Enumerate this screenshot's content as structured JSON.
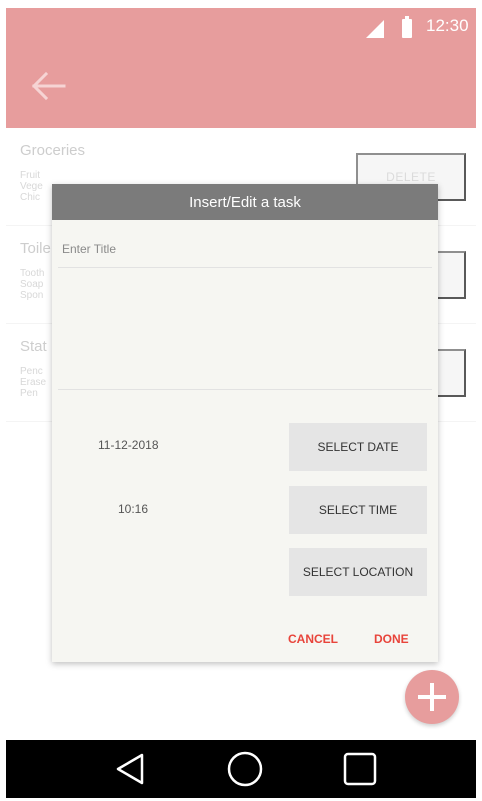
{
  "status_bar": {
    "time": "12:30"
  },
  "app_bar": {
    "back_icon": "arrow-left-icon"
  },
  "list": {
    "cards": [
      {
        "title": "Groceries",
        "items": [
          "Fruit",
          "Vege",
          "Chic"
        ],
        "delete_label": "DELETE"
      },
      {
        "title": "Toile",
        "items": [
          "Tooth",
          "Soap",
          "Spon"
        ],
        "delete_label": ""
      },
      {
        "title": "Stat",
        "items": [
          "Penc",
          "Erase",
          "Pen"
        ],
        "delete_label": ""
      }
    ]
  },
  "dialog": {
    "title": "Insert/Edit a task",
    "title_placeholder": "Enter Title",
    "date_value": "11-12-2018",
    "time_value": "10:16",
    "select_date_label": "SELECT DATE",
    "select_time_label": "SELECT TIME",
    "select_location_label": "SELECT LOCATION",
    "cancel_label": "CANCEL",
    "done_label": "DONE"
  },
  "fab": {
    "icon": "plus-icon"
  },
  "nav": {
    "back_icon": "triangle-back-icon",
    "home_icon": "circle-home-icon",
    "recents_icon": "square-recents-icon"
  },
  "colors": {
    "accent": "#e79d9d",
    "dialog_header": "#7b7b7b",
    "action_text": "#e8443b"
  }
}
